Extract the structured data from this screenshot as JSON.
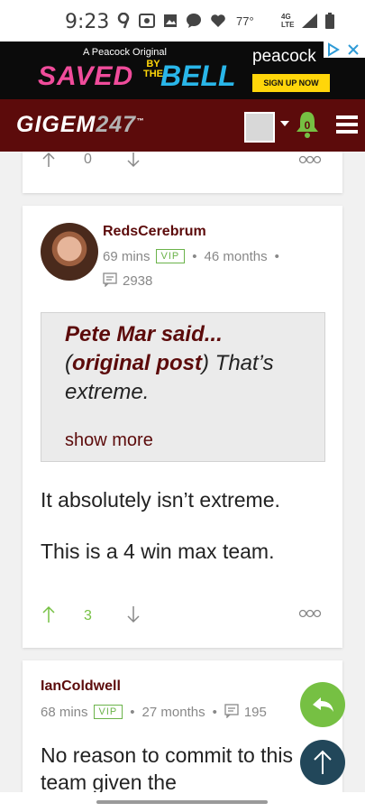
{
  "status_bar": {
    "time": "9:23",
    "temperature": "77°",
    "network": [
      "4G",
      "LTE"
    ]
  },
  "ad": {
    "tagline": "A Peacock Original",
    "title_saved": "SAVED",
    "title_by_the": [
      "BY",
      "THE"
    ],
    "title_bell": "BELL",
    "brand": "peacock",
    "cta": "SIGN UP NOW"
  },
  "header": {
    "logo_text": "GIGEM",
    "logo_num": "247",
    "logo_tm": "™",
    "notification_count": "0"
  },
  "posts": [
    {
      "upvotes": "0"
    },
    {
      "username": "RedsCerebrum",
      "time_ago": "69 mins",
      "badge": "VIP",
      "tenure": "46 months",
      "post_count": "2938",
      "quote": {
        "author": "Pete Mar said...",
        "link": "original post",
        "text": ") That’s extreme.",
        "show_more": "show more"
      },
      "body": [
        "It absolutely isn’t extreme.",
        "This is a 4 win max team."
      ],
      "upvotes": "3"
    },
    {
      "username": "IanColdwell",
      "time_ago": "68 mins",
      "badge": "VIP",
      "tenure": "27 months",
      "post_count": "195",
      "body": "No reason to commit to this team given the"
    }
  ],
  "colors": {
    "brand": "#5c0b0b",
    "accent_green": "#76c043",
    "fab_dark": "#22475a"
  },
  "icons": {
    "reply": "reply-icon",
    "scroll_top": "arrow-up-icon",
    "menu": "hamburger-icon",
    "notifications": "bell-icon"
  }
}
